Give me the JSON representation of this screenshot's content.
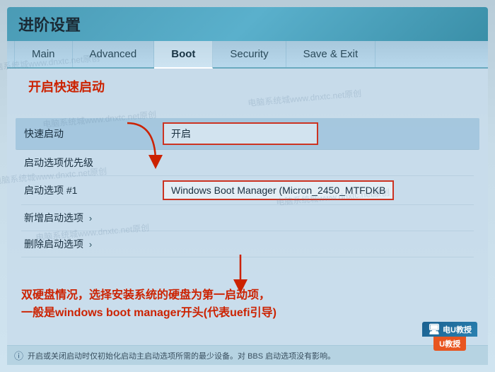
{
  "window": {
    "title": "进阶设置",
    "watermarks": [
      "电脑系统城www.dnxtc.net原创",
      "电脑系统城www.dnxtc.net原创",
      "电脑系统城www.dnxtc.net原创",
      "电脑系统城www.dnxtc.net原创",
      "电脑系统城www.dnxtc.net原创"
    ]
  },
  "tabs": [
    {
      "id": "main",
      "label": "Main",
      "active": false
    },
    {
      "id": "advanced",
      "label": "Advanced",
      "active": false
    },
    {
      "id": "boot",
      "label": "Boot",
      "active": true
    },
    {
      "id": "security",
      "label": "Security",
      "active": false
    },
    {
      "id": "save-exit",
      "label": "Save & Exit",
      "active": false
    }
  ],
  "annotation1": {
    "label": "开启快速启动"
  },
  "settings": [
    {
      "id": "quick-boot",
      "label": "快速启动",
      "value": "开启",
      "type": "box",
      "highlighted": true
    },
    {
      "id": "boot-options-priority",
      "label": "启动选项优先级",
      "value": "",
      "type": "text",
      "highlighted": false
    },
    {
      "id": "boot-option-1",
      "label": "启动选项 #1",
      "value": "Windows Boot Manager (Micron_2450_MTFDKB",
      "type": "box",
      "highlighted": false
    },
    {
      "id": "add-boot-option",
      "label": "新增启动选项",
      "value": "›",
      "type": "chevron",
      "highlighted": false
    },
    {
      "id": "delete-boot-option",
      "label": "删除启动选项",
      "value": "›",
      "type": "chevron",
      "highlighted": false
    }
  ],
  "annotation2": {
    "line1": "双硬盘情况，选择安装系统的硬盘为第一启动项，",
    "line2": "一般是windows boot manager开头(代表uefi引导)"
  },
  "status_bar": {
    "text": "开启或关闭启动时仅初始化启动主启动选项所需的最少设备。对 BBS 启动选项没有影响。"
  },
  "logo": {
    "top": "电U教授",
    "bottom": "U教授"
  }
}
